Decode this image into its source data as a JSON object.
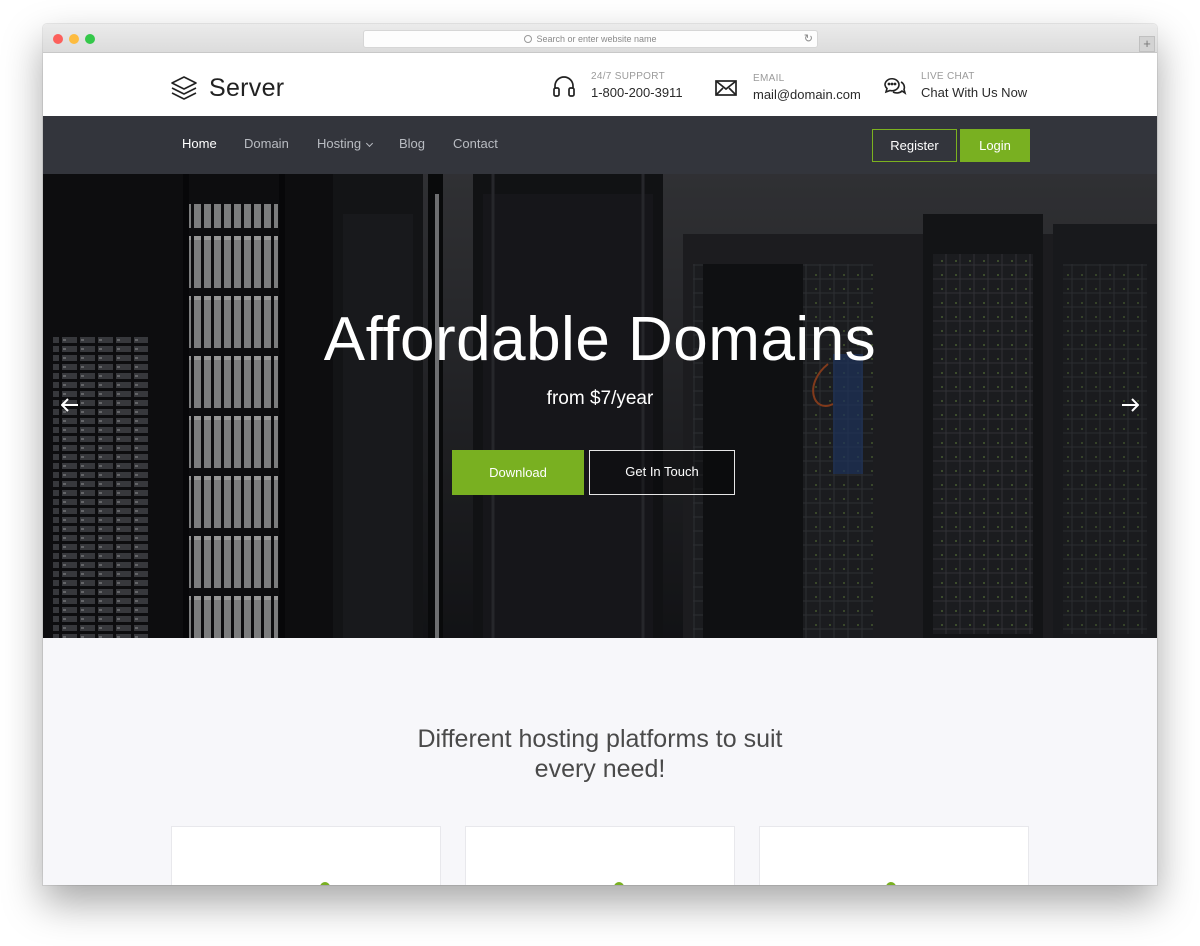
{
  "browser": {
    "url_placeholder": "Search or enter website name"
  },
  "header": {
    "logo_text": "Server",
    "support": {
      "label": "24/7 SUPPORT",
      "value": "1-800-200-3911"
    },
    "email": {
      "label": "EMAIL",
      "value": "mail@domain.com"
    },
    "chat": {
      "label": "LIVE CHAT",
      "value": "Chat With Us Now"
    }
  },
  "nav": {
    "items": [
      {
        "label": "Home",
        "active": true
      },
      {
        "label": "Domain"
      },
      {
        "label": "Hosting",
        "has_dropdown": true
      },
      {
        "label": "Blog"
      },
      {
        "label": "Contact"
      }
    ],
    "register_label": "Register",
    "login_label": "Login"
  },
  "hero": {
    "title": "Affordable Domains",
    "subtitle": "from $7/year",
    "download_label": "Download",
    "touch_label": "Get In Touch"
  },
  "section": {
    "title_line1": "Different hosting platforms to suit",
    "title_line2": "every need!"
  },
  "colors": {
    "accent": "#79b021",
    "nav_bg": "#33353c",
    "section_bg": "#f7f7fa"
  }
}
